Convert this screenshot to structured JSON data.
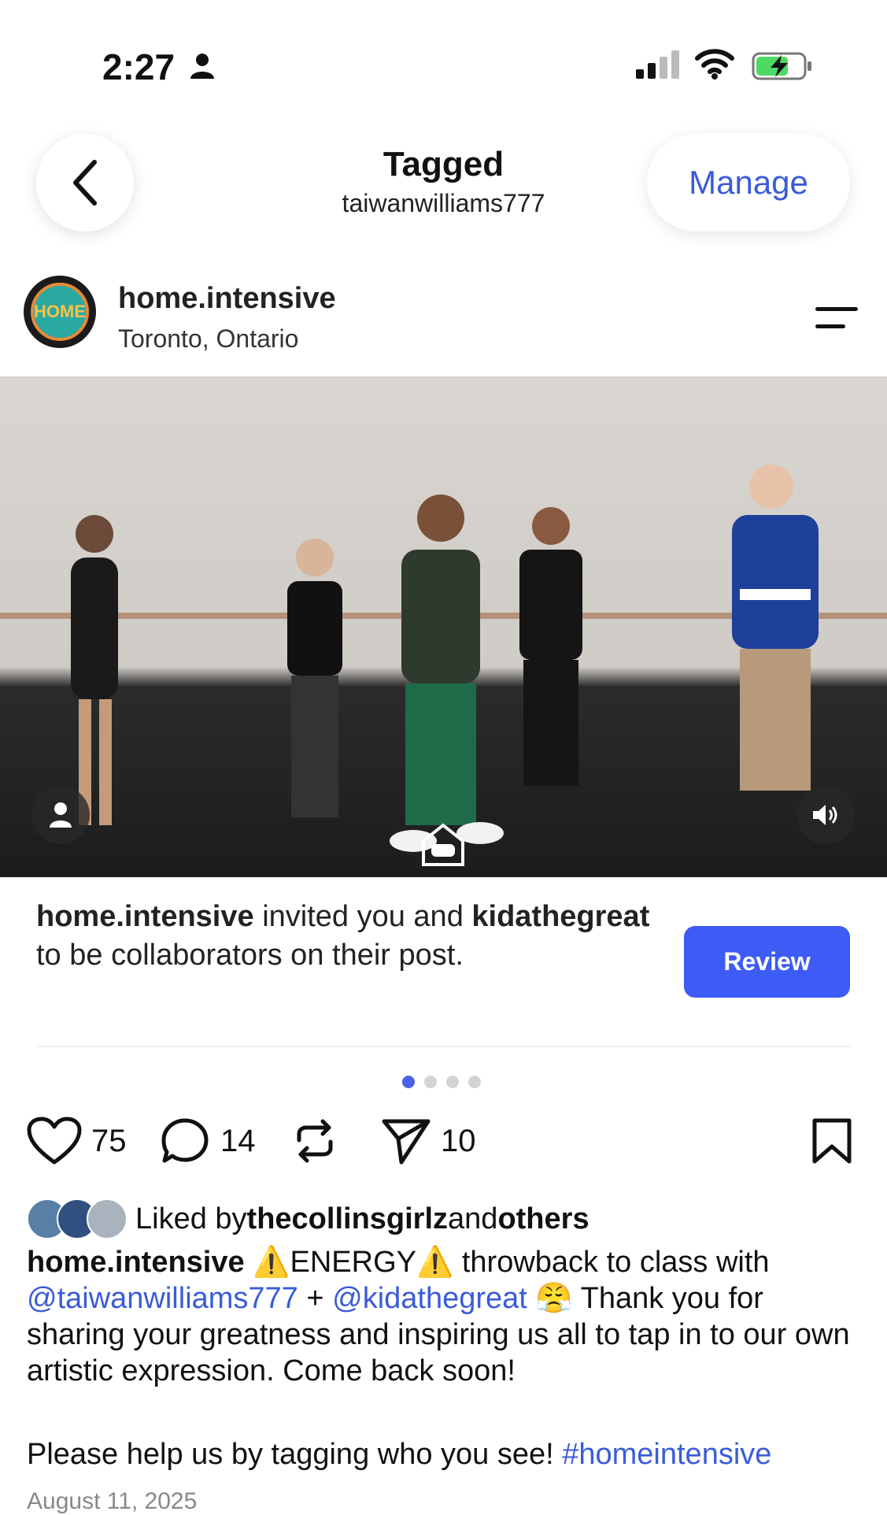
{
  "status_bar": {
    "time": "2:27"
  },
  "header": {
    "title": "Tagged",
    "subtitle": "taiwanwilliams777",
    "manage_label": "Manage"
  },
  "post": {
    "username": "home.intensive",
    "location": "Toronto, Ontario",
    "invite": {
      "user1": "home.intensive",
      "text1": " invited you and ",
      "user2": "kidathegreat",
      "text2": " to be collaborators on their post."
    },
    "review_label": "Review",
    "carousel": {
      "count": 4,
      "active_index": 0
    },
    "actions": {
      "likes": "75",
      "comments": "14",
      "shares": "10"
    },
    "liked_by": {
      "prefix": "Liked by ",
      "user": "thecollinsgirlz",
      "middle": " and ",
      "others": "others"
    },
    "caption": {
      "author": "home.intensive",
      "part1": " ⚠️ENERGY⚠️ throwback to class with ",
      "mention1": "@taiwanwilliams777",
      "part2": " + ",
      "mention2": "@kidathegreat",
      "part3": " 😤 Thank you for sharing your greatness and inspiring us all to tap in to our own artistic expression. Come back soon!",
      "line2": "Please help us by tagging who you see! ",
      "hashtag": "#homeintensive"
    },
    "date": "August 11, 2025",
    "avatar_text": "HOME"
  },
  "colors": {
    "accent": "#3d5bf5",
    "link": "#3a5bd9"
  }
}
